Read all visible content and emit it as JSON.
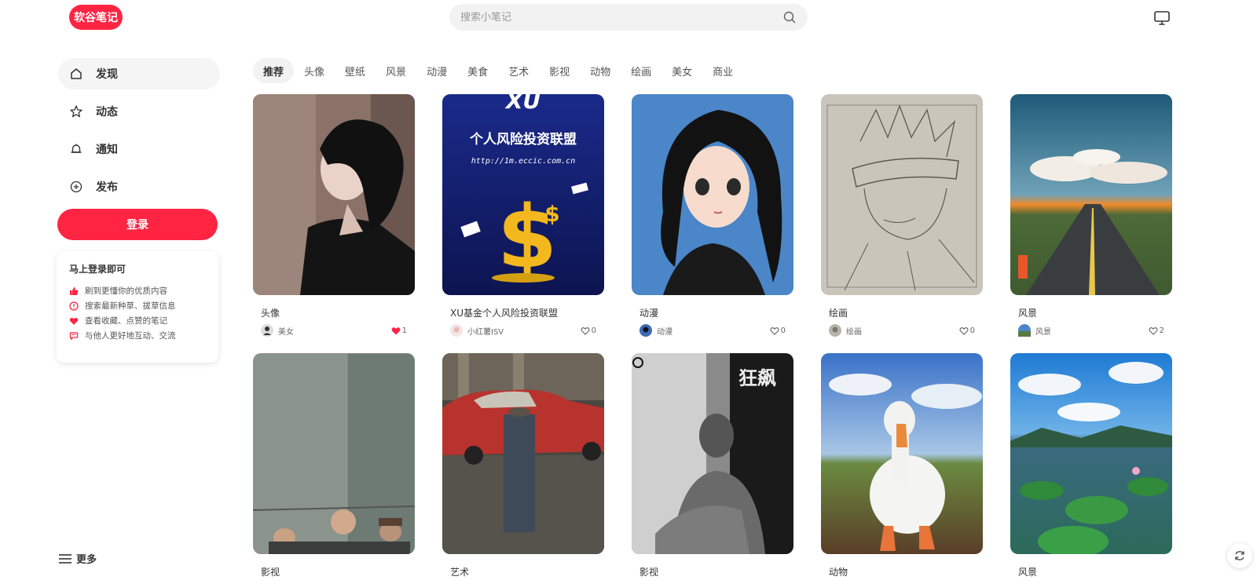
{
  "header": {
    "logo": "软谷笔记",
    "search_placeholder": "搜索小笔记"
  },
  "sidebar": {
    "items": [
      {
        "label": "发现",
        "icon": "home-icon"
      },
      {
        "label": "动态",
        "icon": "star-icon"
      },
      {
        "label": "通知",
        "icon": "bell-icon"
      },
      {
        "label": "发布",
        "icon": "plus-circle-icon"
      }
    ],
    "login_label": "登录",
    "promo": {
      "title": "马上登录即可",
      "rows": [
        "刷到更懂你的优质内容",
        "搜索最新种草、拔草信息",
        "查看收藏、点赞的笔记",
        "与他人更好地互动、交流"
      ]
    },
    "more_label": "更多"
  },
  "tabs": [
    "推荐",
    "头像",
    "壁纸",
    "风景",
    "动漫",
    "美食",
    "艺术",
    "影视",
    "动物",
    "绘画",
    "美女",
    "商业"
  ],
  "cards": [
    {
      "title": "头像",
      "author": "美女",
      "likes": "1",
      "liked": true,
      "image": "woman-portrait-image"
    },
    {
      "title": "XU基金个人风险投资联盟",
      "author": "小红薯ISV",
      "likes": "0",
      "liked": false,
      "image": "finance-poster-image"
    },
    {
      "title": "动漫",
      "author": "动漫",
      "likes": "0",
      "liked": false,
      "image": "anime-girl-image"
    },
    {
      "title": "绘画",
      "author": "绘画",
      "likes": "0",
      "liked": false,
      "image": "pencil-sketch-image"
    },
    {
      "title": "风景",
      "author": "风景",
      "likes": "2",
      "liked": false,
      "image": "highway-sunset-image"
    },
    {
      "title": "影视",
      "image": "prison-yard-image"
    },
    {
      "title": "艺术",
      "image": "red-car-street-image"
    },
    {
      "title": "影视",
      "image": "bw-movie-poster-image"
    },
    {
      "title": "动物",
      "image": "white-duck-image"
    },
    {
      "title": "风景",
      "image": "lotus-lake-image"
    }
  ],
  "poster_text": {
    "brand": "XU",
    "headline": "个人风险投资联盟",
    "url": "http://1m.eccic.com.cn",
    "bw_title": "狂飙"
  },
  "colors": {
    "brand": "#ff2442",
    "liked_heart": "#ff2442"
  }
}
